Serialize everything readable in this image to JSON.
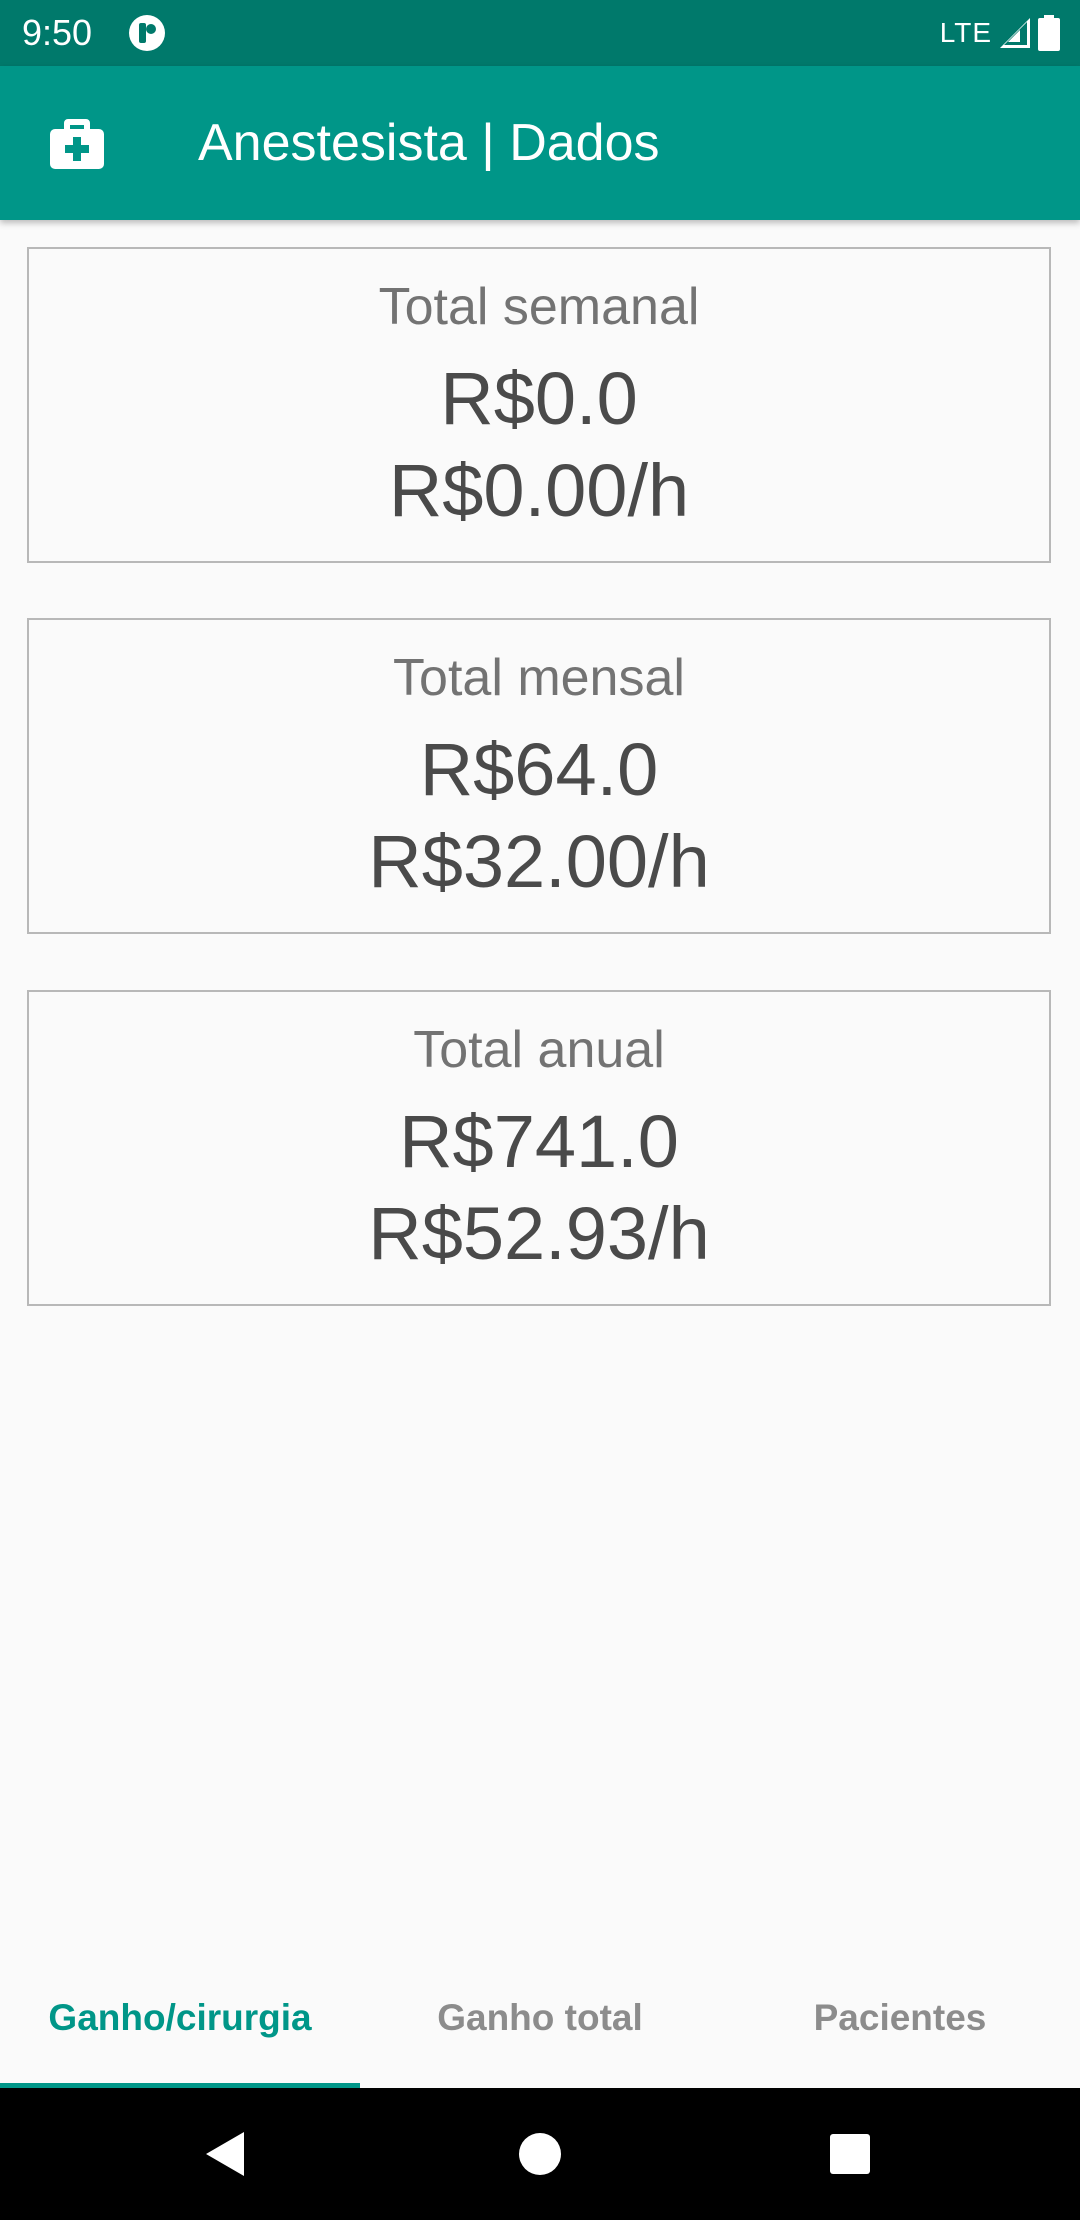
{
  "status_bar": {
    "time": "9:50",
    "network": "LTE",
    "icons": [
      "app-notification-icon",
      "signal-icon",
      "battery-icon"
    ]
  },
  "app_bar": {
    "title": "Anestesista | Dados",
    "icon": "medical-kit-icon"
  },
  "cards": [
    {
      "label": "Total semanal",
      "total": "R$0.0",
      "rate": "R$0.00/h"
    },
    {
      "label": "Total mensal",
      "total": "R$64.0",
      "rate": "R$32.00/h"
    },
    {
      "label": "Total anual",
      "total": "R$741.0",
      "rate": "R$52.93/h"
    }
  ],
  "tabs": [
    {
      "label": "Ganho/cirurgia",
      "selected": true
    },
    {
      "label": "Ganho total",
      "selected": false
    },
    {
      "label": "Pacientes",
      "selected": false
    }
  ],
  "nav": {
    "icons": [
      "back-icon",
      "home-icon",
      "recents-icon"
    ]
  },
  "colors": {
    "primary": "#009688",
    "primary_dark": "#00796b",
    "background": "#fafafa",
    "card_border": "#b8b8b8",
    "text_primary": "#4a4a4a",
    "text_secondary": "#737373",
    "tab_inactive": "#8c8c8c"
  }
}
